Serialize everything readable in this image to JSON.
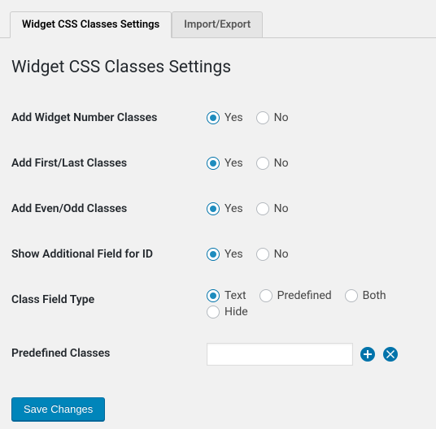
{
  "tabs": {
    "settings": "Widget CSS Classes Settings",
    "import_export": "Import/Export"
  },
  "page_title": "Widget CSS Classes Settings",
  "yes": "Yes",
  "no": "No",
  "fields": {
    "add_number": "Add Widget Number Classes",
    "add_first_last": "Add First/Last Classes",
    "add_even_odd": "Add Even/Odd Classes",
    "show_id_field": "Show Additional Field for ID",
    "class_field_type": "Class Field Type",
    "predefined_classes": "Predefined Classes"
  },
  "class_type_options": {
    "text": "Text",
    "predefined": "Predefined",
    "both": "Both",
    "hide": "Hide"
  },
  "predefined_value": "",
  "save_button": "Save Changes"
}
